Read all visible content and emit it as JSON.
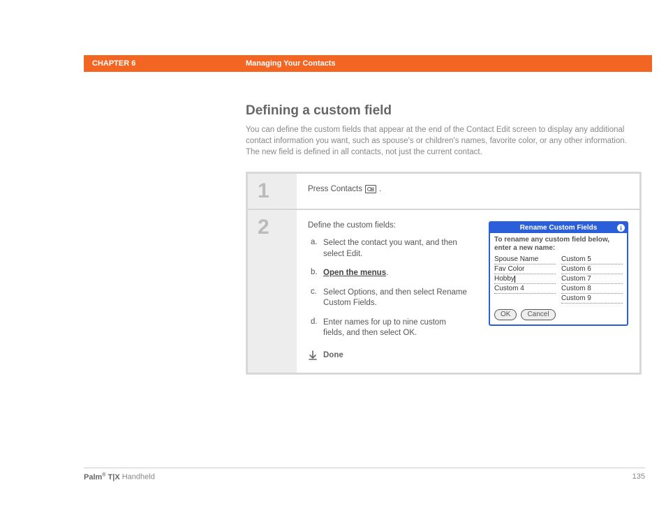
{
  "header": {
    "chapter": "CHAPTER 6",
    "title": "Managing Your Contacts"
  },
  "section": {
    "title": "Defining a custom field",
    "desc": "You can define the custom fields that appear at the end of the Contact Edit screen to display any additional contact information you want, such as spouse's or children's names, favorite color, or any other information. The new field is defined in all contacts, not just the current contact."
  },
  "steps": {
    "s1": {
      "num": "1",
      "text_pre": "Press Contacts ",
      "text_post": "."
    },
    "s2": {
      "num": "2",
      "intro": "Define the custom fields:",
      "items": {
        "a": {
          "letter": "a.",
          "text": "Select the contact you want, and then select Edit."
        },
        "b": {
          "letter": "b.",
          "link": "Open the menus",
          "suffix": "."
        },
        "c": {
          "letter": "c.",
          "text": "Select Options, and then select Rename Custom Fields."
        },
        "d": {
          "letter": "d.",
          "text": "Enter names for up to nine custom fields, and then select OK."
        }
      },
      "done": "Done"
    }
  },
  "palm": {
    "title": "Rename Custom Fields",
    "instr": "To rename any custom field below, enter a new name:",
    "left": [
      "Spouse Name",
      "Fav Color",
      "Hobby",
      "Custom 4"
    ],
    "right": [
      "Custom 5",
      "Custom 6",
      "Custom 7",
      "Custom 8",
      "Custom 9"
    ],
    "ok": "OK",
    "cancel": "Cancel"
  },
  "footer": {
    "brand_pre": "Palm",
    "brand_mid": " T|X",
    "brand_post": " Handheld",
    "page": "135"
  }
}
